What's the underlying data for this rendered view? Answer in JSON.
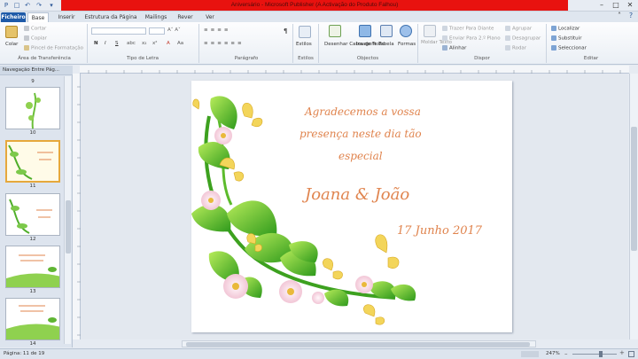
{
  "window": {
    "title": "Aniversário - Microsoft Publisher (A Activação do Produto Falhou)"
  },
  "tabs": [
    "Ficheiro",
    "Base",
    "Inserir",
    "Estrutura da Página",
    "Mailings",
    "Rever",
    "Ver"
  ],
  "ribbon": {
    "clipboard": {
      "paste": "Colar",
      "cut": "Cortar",
      "copy": "Copiar",
      "format_painter": "Pincel de Formatação",
      "label": "Área de Transferência"
    },
    "font": {
      "label": "Tipo de Letra",
      "bold": "N",
      "italic": "I",
      "underline": "S"
    },
    "paragraph": {
      "label": "Parágrafo"
    },
    "styles": {
      "button": "Estilos",
      "label": "Estilos"
    },
    "objects": {
      "draw_textbox": "Desenhar Caixa de Texto",
      "image": "Imagem",
      "table": "Tabela",
      "shapes": "Formas",
      "label": "Objectos"
    },
    "arrange": {
      "wrap_text": "Moldar Texto",
      "bring_forward": "Trazer Para Diante",
      "send_backward": "Enviar Para 2.º Plano",
      "align": "Alinhar",
      "group": "Agrupar",
      "ungroup": "Desagrupar",
      "rotate": "Rodar",
      "label": "Dispor"
    },
    "editing": {
      "find": "Localizar",
      "replace": "Substituir",
      "select": "Seleccionar",
      "label": "Editar"
    }
  },
  "nav": {
    "header": "Navegação Entre Pág...",
    "pages": [
      "9",
      "10",
      "11",
      "12",
      "13",
      "14"
    ]
  },
  "document": {
    "line1": "Agradecemos a vossa",
    "line2": "presença neste dia tão",
    "line3": "especial",
    "names": "Joana & João",
    "date": "17 Junho 2017"
  },
  "status": {
    "pages": "Página: 11 de 19",
    "zoom": "247%"
  },
  "colors": {
    "script_text": "#e0844e",
    "file_tab": "#1e5aa8",
    "title_bar": "#e8120f"
  }
}
